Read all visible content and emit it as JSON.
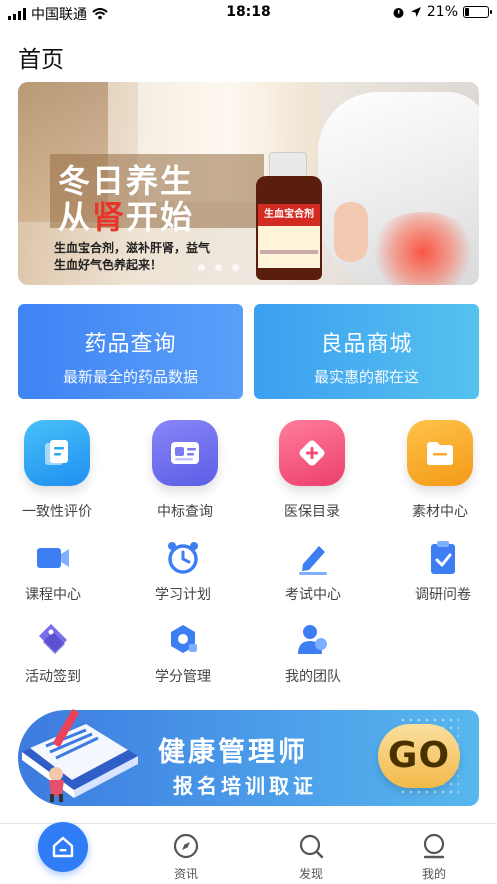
{
  "status_bar": {
    "carrier": "中国联通",
    "time": "18:18",
    "battery": "21%",
    "battery_level": 0.21
  },
  "page": {
    "title": "首页"
  },
  "banner": {
    "headline_1": "冬日养生",
    "headline_2_a": "从",
    "headline_2_red": "肾",
    "headline_2_b": "开始",
    "description": "生血宝合剂，滋补肝肾，益气生血好气色养起来！",
    "product_label": "生血宝合剂",
    "page_count": 3
  },
  "feature_cards": [
    {
      "title": "药品查询",
      "subtitle": "最新最全的药品数据"
    },
    {
      "title": "良品商城",
      "subtitle": "最实惠的都在这"
    }
  ],
  "main_grid": [
    {
      "label": "一致性评价",
      "icon": "document-icon",
      "color": "#2aa7f5"
    },
    {
      "label": "中标查询",
      "icon": "id-card-icon",
      "color": "#6b6ef0"
    },
    {
      "label": "医保目录",
      "icon": "medical-plus-icon",
      "color": "#f0527a"
    },
    {
      "label": "素材中心",
      "icon": "folder-icon",
      "color": "#f6a623"
    }
  ],
  "secondary_grid": [
    {
      "label": "课程中心",
      "icon": "video-camera-icon"
    },
    {
      "label": "学习计划",
      "icon": "alarm-clock-icon"
    },
    {
      "label": "考试中心",
      "icon": "pencil-icon"
    },
    {
      "label": "调研问卷",
      "icon": "clipboard-check-icon"
    },
    {
      "label": "活动签到",
      "icon": "tag-icon"
    },
    {
      "label": "学分管理",
      "icon": "hexagon-icon"
    },
    {
      "label": "我的团队",
      "icon": "team-icon"
    }
  ],
  "ad_banner": {
    "title": "健康管理师",
    "subtitle": "报名培训取证",
    "button": "GO"
  },
  "tab_bar": [
    {
      "label": "",
      "icon": "home-icon",
      "active": true
    },
    {
      "label": "资讯",
      "icon": "compass-icon"
    },
    {
      "label": "发现",
      "icon": "search-icon"
    },
    {
      "label": "我的",
      "icon": "user-icon"
    }
  ],
  "colors": {
    "accent": "#2f7cf6",
    "icon_blue": "#3d7ff2"
  }
}
